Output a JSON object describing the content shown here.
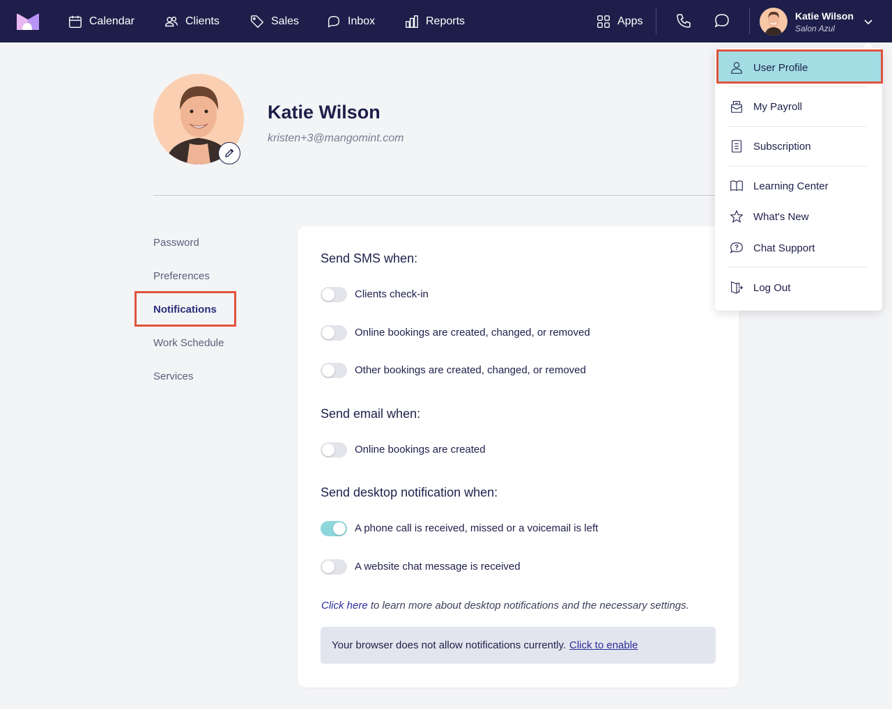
{
  "nav": {
    "calendar": "Calendar",
    "clients": "Clients",
    "sales": "Sales",
    "inbox": "Inbox",
    "reports": "Reports",
    "apps": "Apps"
  },
  "user": {
    "name": "Katie Wilson",
    "salon": "Salon Azul"
  },
  "profile": {
    "name": "Katie Wilson",
    "email": "kristen+3@mangomint.com"
  },
  "sidebar": {
    "items": [
      {
        "label": "Password"
      },
      {
        "label": "Preferences"
      },
      {
        "label": "Notifications",
        "active": true
      },
      {
        "label": "Work Schedule"
      },
      {
        "label": "Services"
      }
    ]
  },
  "sms": {
    "title": "Send SMS when:",
    "options": [
      {
        "label": "Clients check-in",
        "enabled": false
      },
      {
        "label": "Online bookings are created, changed, or removed",
        "enabled": false
      },
      {
        "label": "Other bookings are created, changed, or removed",
        "enabled": false
      }
    ]
  },
  "email": {
    "title": "Send email when:",
    "options": [
      {
        "label": "Online bookings are created",
        "enabled": false
      }
    ]
  },
  "desktop": {
    "title": "Send desktop notification when:",
    "options": [
      {
        "label": "A phone call is received, missed or a voicemail is left",
        "enabled": true
      },
      {
        "label": "A website chat message is received",
        "enabled": false
      }
    ]
  },
  "help": {
    "link": "Click here",
    "text": " to learn more about desktop notifications and the necessary settings."
  },
  "notice": {
    "text": "Your browser does not allow notifications currently.",
    "link": "Click to enable"
  },
  "menu": {
    "items": [
      {
        "label": "User Profile",
        "icon": "user-icon",
        "active": true
      },
      {
        "label": "My Payroll",
        "icon": "payroll-icon"
      },
      {
        "label": "Subscription",
        "icon": "receipt-icon"
      },
      {
        "label": "Learning Center",
        "icon": "book-icon"
      },
      {
        "label": "What's New",
        "icon": "star-icon"
      },
      {
        "label": "Chat Support",
        "icon": "chat-question-icon"
      },
      {
        "label": "Log Out",
        "icon": "logout-icon"
      }
    ]
  },
  "colors": {
    "topbar": "#1d1f4a",
    "accent_toggle": "#8fd6dc",
    "highlight_border": "#e0533d",
    "menu_active": "#a3dde3"
  }
}
